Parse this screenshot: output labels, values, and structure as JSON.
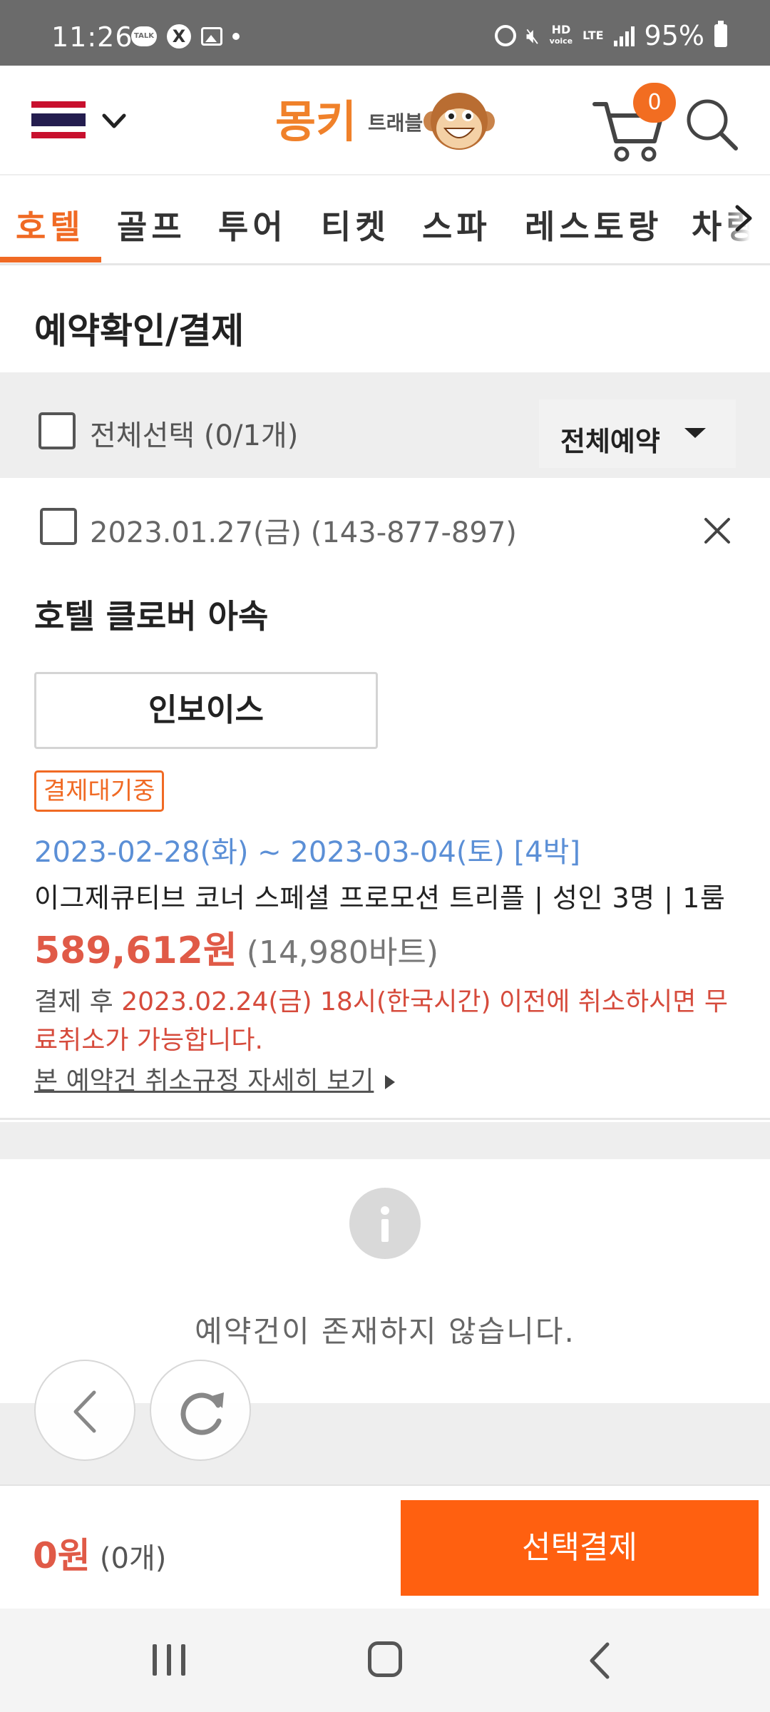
{
  "status_bar": {
    "time": "11:26",
    "talk_badge": "TALK",
    "battery": "95%",
    "hd_label": "HD",
    "voice_label": "voice",
    "lte_label": "LTE"
  },
  "header": {
    "cart_count": "0",
    "logo_text": "몽키 트래블"
  },
  "tabs": [
    "호텔",
    "골프",
    "투어",
    "티켓",
    "스파",
    "레스토랑",
    "차량"
  ],
  "page_title": "예약확인/결제",
  "select_all": {
    "label": "전체선택 (0/1개)",
    "filter_label": "전체예약"
  },
  "reservation": {
    "date_id": "2023.01.27(금) (143-877-897)",
    "hotel_name": "호텔 클로버 아속",
    "invoice_button": "인보이스",
    "status": "결제대기중",
    "stay_period": "2023-02-28(화) ~ 2023-03-04(토) [4박]",
    "room_info": "이그제큐티브 코너 스페셜 프로모션 트리플 | 성인 3명 | 1룸",
    "price_won": "589,612원",
    "price_baht": "(14,980바트)",
    "cancel_prefix": "결제 후 ",
    "cancel_note": "2023.02.24(금) 18시(한국시간) 이전에 취소하시면 무료취소가 가능합니다.",
    "policy_link": "본 예약건 취소규정 자세히 보기"
  },
  "empty_message": "예약건이 존재하지 않습니다.",
  "bottom_bar": {
    "total_amount": "0원",
    "total_count": "(0개)",
    "pay_button": "선택결제"
  },
  "colors": {
    "accent": "#f06a24",
    "pay_button": "#ff6010",
    "price": "#e05a47",
    "date_blue": "#5b8fd6",
    "cancel_red": "#d64b3c"
  }
}
